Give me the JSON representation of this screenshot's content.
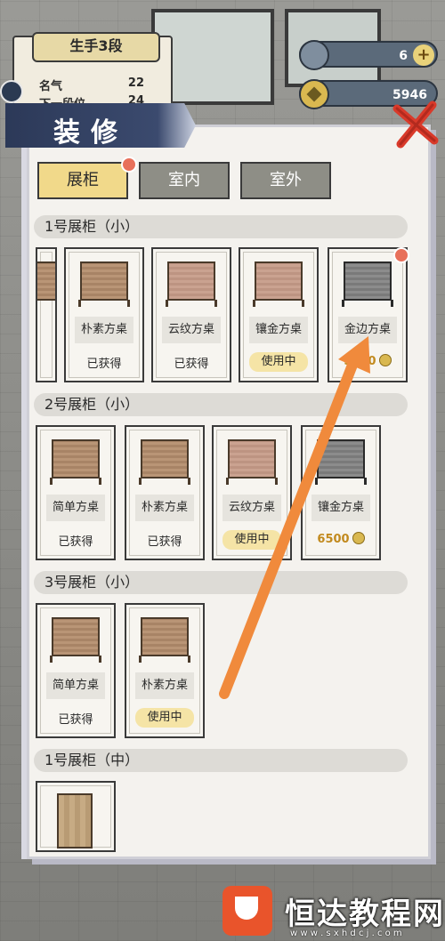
{
  "rank": {
    "title": "生手3段",
    "rows": [
      {
        "label": "名气",
        "value": "22"
      },
      {
        "label": "下一段位",
        "value": "24"
      }
    ]
  },
  "currency": {
    "top_value": "6",
    "coins": "5946",
    "plus": "+"
  },
  "panel": {
    "title": "装修"
  },
  "tabs": [
    {
      "label": "展柜",
      "active": true
    },
    {
      "label": "室内",
      "active": false
    },
    {
      "label": "室外",
      "active": false
    }
  ],
  "sections": [
    {
      "title": "1号展柜（小）",
      "items": [
        {
          "name": "",
          "status": "",
          "style": "wood"
        },
        {
          "name": "朴素方桌",
          "status": "已获得",
          "style": "wood"
        },
        {
          "name": "云纹方桌",
          "status": "已获得",
          "style": "pink"
        },
        {
          "name": "镶金方桌",
          "status": "使用中",
          "style": "pink"
        },
        {
          "name": "金边方桌",
          "price": "5500",
          "style": "dark"
        }
      ]
    },
    {
      "title": "2号展柜（小）",
      "items": [
        {
          "name": "简单方桌",
          "status": "已获得",
          "style": "wood"
        },
        {
          "name": "朴素方桌",
          "status": "已获得",
          "style": "wood"
        },
        {
          "name": "云纹方桌",
          "status": "使用中",
          "style": "pink"
        },
        {
          "name": "镶金方桌",
          "price": "6500",
          "style": "dark"
        }
      ]
    },
    {
      "title": "3号展柜（小）",
      "items": [
        {
          "name": "简单方桌",
          "status": "已获得",
          "style": "wood"
        },
        {
          "name": "朴素方桌",
          "status": "使用中",
          "style": "wood"
        }
      ]
    },
    {
      "title": "1号展柜（中）",
      "items": [
        {
          "name": "",
          "status": "",
          "style": "tall"
        }
      ]
    }
  ],
  "watermark": {
    "text": "恒达教程网",
    "url": "w w w . s x h d c j . c o m"
  },
  "colors": {
    "accent_orange": "#f08a3c",
    "tab_active": "#f1d98a",
    "price_gold": "#c28a1e",
    "in_use_bg": "#f5e4a6"
  }
}
